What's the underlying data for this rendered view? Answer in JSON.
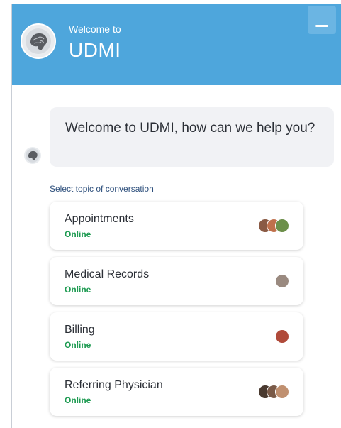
{
  "header": {
    "subtitle": "Welcome to",
    "title": "UDMI",
    "avatar_icon": "brain-logo-icon",
    "minimize_icon": "minimize-icon",
    "color": "#4ea6dc"
  },
  "conversation": {
    "bot_avatar_icon": "brain-logo-icon",
    "welcome_message": "Welcome to UDMI, how can we help you?",
    "topic_prompt": "Select topic of conversation"
  },
  "topics": [
    {
      "name": "Appointments",
      "status": "Online",
      "agent_colors": [
        "#8a5a44",
        "#c0704c",
        "#6c8f4a"
      ]
    },
    {
      "name": "Medical Records",
      "status": "Online",
      "agent_colors": [
        "#9a8a80"
      ]
    },
    {
      "name": "Billing",
      "status": "Online",
      "agent_colors": [
        "#b04a3a"
      ]
    },
    {
      "name": "Referring Physician",
      "status": "Online",
      "agent_colors": [
        "#4a3a30",
        "#7a5a48",
        "#c09070"
      ]
    }
  ],
  "colors": {
    "status_online": "#1e9b52",
    "bubble_bg": "#f1f2f5"
  }
}
